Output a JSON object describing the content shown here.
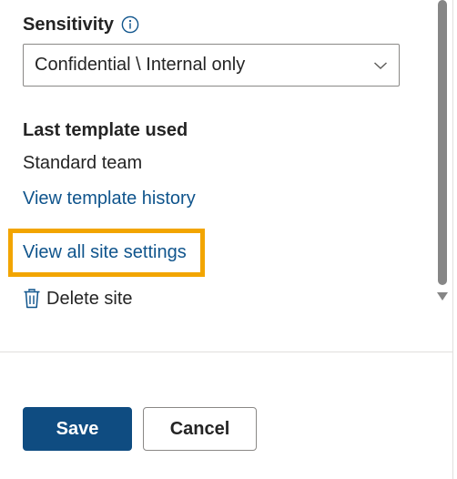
{
  "sensitivity": {
    "label": "Sensitivity",
    "selected": "Confidential \\ Internal only"
  },
  "last_template": {
    "heading": "Last template used",
    "value": "Standard team",
    "history_link": "View template history"
  },
  "links": {
    "view_all_settings": "View all site settings"
  },
  "actions": {
    "delete_label": "Delete site",
    "save_label": "Save",
    "cancel_label": "Cancel"
  },
  "colors": {
    "link": "#0f548c",
    "primary": "#0f4c81",
    "highlight": "#f2a500"
  },
  "icons": {
    "sensitivity_info": "info-icon",
    "select_chevron": "chevron-down-icon",
    "delete": "trash-icon"
  }
}
